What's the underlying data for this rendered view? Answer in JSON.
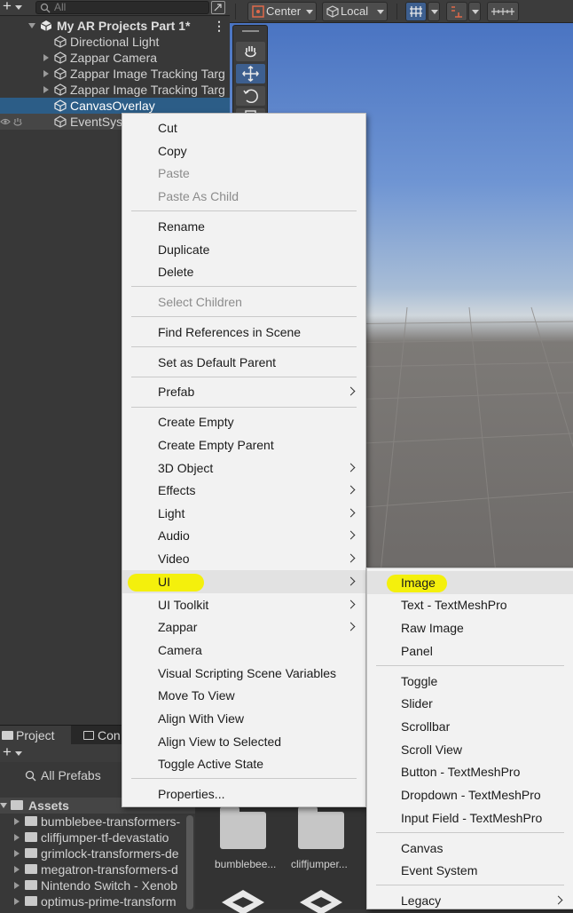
{
  "hierarchy": {
    "search_placeholder": "All",
    "items": [
      {
        "label": "My AR Projects Part 1*"
      },
      {
        "label": "Directional Light"
      },
      {
        "label": "Zappar Camera"
      },
      {
        "label": "Zappar Image Tracking Targ"
      },
      {
        "label": "Zappar Image Tracking Targ"
      },
      {
        "label": "CanvasOverlay"
      },
      {
        "label": "EventSys"
      }
    ]
  },
  "scene_toolbar": {
    "pivot_label": "Center",
    "space_label": "Local"
  },
  "project": {
    "tabs": [
      {
        "label": "Project"
      },
      {
        "label": "Con"
      }
    ],
    "favorites_item": "All Prefabs",
    "root_label": "Assets",
    "folders": [
      {
        "label": "bumblebee-transformers-"
      },
      {
        "label": "cliffjumper-tf-devastatio"
      },
      {
        "label": "grimlock-transformers-de"
      },
      {
        "label": "megatron-transformers-d"
      },
      {
        "label": "Nintendo Switch - Xenob"
      },
      {
        "label": "optimus-prime-transform"
      }
    ],
    "grid_labels": [
      "bumblebee...",
      "cliffjumper..."
    ]
  },
  "context_menu": {
    "items": [
      {
        "label": "Cut"
      },
      {
        "label": "Copy"
      },
      {
        "label": "Paste"
      },
      {
        "label": "Paste As Child"
      },
      {
        "label": "Rename"
      },
      {
        "label": "Duplicate"
      },
      {
        "label": "Delete"
      },
      {
        "label": "Select Children"
      },
      {
        "label": "Find References in Scene"
      },
      {
        "label": "Set as Default Parent"
      },
      {
        "label": "Prefab"
      },
      {
        "label": "Create Empty"
      },
      {
        "label": "Create Empty Parent"
      },
      {
        "label": "3D Object"
      },
      {
        "label": "Effects"
      },
      {
        "label": "Light"
      },
      {
        "label": "Audio"
      },
      {
        "label": "Video"
      },
      {
        "label": "UI"
      },
      {
        "label": "UI Toolkit"
      },
      {
        "label": "Zappar"
      },
      {
        "label": "Camera"
      },
      {
        "label": "Visual Scripting Scene Variables"
      },
      {
        "label": "Move To View"
      },
      {
        "label": "Align With View"
      },
      {
        "label": "Align View to Selected"
      },
      {
        "label": "Toggle Active State"
      },
      {
        "label": "Properties..."
      }
    ]
  },
  "ui_submenu": {
    "items": [
      {
        "label": "Image"
      },
      {
        "label": "Text - TextMeshPro"
      },
      {
        "label": "Raw Image"
      },
      {
        "label": "Panel"
      },
      {
        "label": "Toggle"
      },
      {
        "label": "Slider"
      },
      {
        "label": "Scrollbar"
      },
      {
        "label": "Scroll View"
      },
      {
        "label": "Button - TextMeshPro"
      },
      {
        "label": "Dropdown - TextMeshPro"
      },
      {
        "label": "Input Field - TextMeshPro"
      },
      {
        "label": "Canvas"
      },
      {
        "label": "Event System"
      },
      {
        "label": "Legacy"
      }
    ]
  },
  "colors": {
    "selection": "#2c5d87",
    "highlighter": "#f4f000",
    "menu_bg": "#f2f2f2"
  }
}
